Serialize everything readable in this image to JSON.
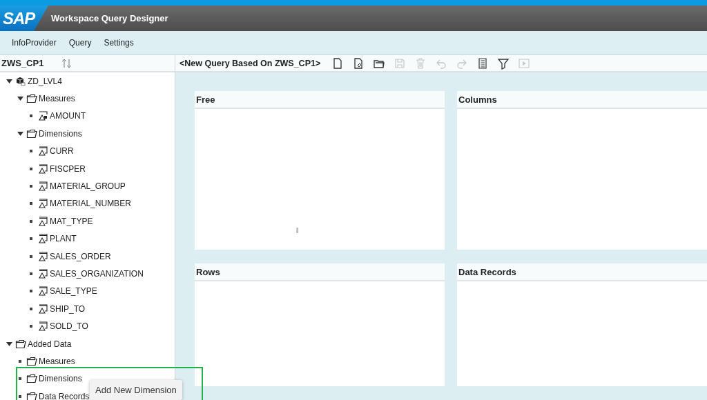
{
  "header": {
    "logo": "SAP",
    "title": "Workspace Query Designer"
  },
  "menu": [
    "InfoProvider",
    "Query",
    "Settings"
  ],
  "provider": {
    "title": "ZWS_CP1"
  },
  "tree": [
    {
      "label": "ZD_LVL4",
      "kind": "cube",
      "expanded": true,
      "children": [
        {
          "label": "Measures",
          "kind": "folder",
          "expanded": true,
          "children": [
            {
              "label": "AMOUNT",
              "kind": "measure"
            }
          ]
        },
        {
          "label": "Dimensions",
          "kind": "folder",
          "expanded": true,
          "children": [
            {
              "label": "CURR",
              "kind": "dimension"
            },
            {
              "label": "FISCPER",
              "kind": "dimension"
            },
            {
              "label": "MATERIAL_GROUP",
              "kind": "dimension"
            },
            {
              "label": "MATERIAL_NUMBER",
              "kind": "dimension"
            },
            {
              "label": "MAT_TYPE",
              "kind": "dimension"
            },
            {
              "label": "PLANT",
              "kind": "dimension"
            },
            {
              "label": "SALES_ORDER",
              "kind": "dimension"
            },
            {
              "label": "SALES_ORGANIZATION",
              "kind": "dimension"
            },
            {
              "label": "SALE_TYPE",
              "kind": "dimension"
            },
            {
              "label": "SHIP_TO",
              "kind": "dimension"
            },
            {
              "label": "SOLD_TO",
              "kind": "dimension"
            }
          ]
        }
      ]
    },
    {
      "label": "Added Data",
      "kind": "folder",
      "expanded": true,
      "children": [
        {
          "label": "Measures",
          "kind": "folder"
        },
        {
          "label": "Dimensions",
          "kind": "folder"
        },
        {
          "label": "Data Records",
          "kind": "folder"
        }
      ]
    }
  ],
  "query": {
    "title": "<New Query Based On ZWS_CP1>"
  },
  "toolbar": [
    {
      "kind": "new",
      "disabled": false
    },
    {
      "kind": "edit",
      "disabled": false
    },
    {
      "kind": "open",
      "disabled": false
    },
    {
      "kind": "save",
      "disabled": true
    },
    {
      "kind": "delete",
      "disabled": true
    },
    {
      "kind": "undo",
      "disabled": true
    },
    {
      "kind": "redo",
      "disabled": true
    },
    {
      "kind": "list",
      "disabled": false
    },
    {
      "kind": "filter",
      "disabled": false
    },
    {
      "kind": "execute",
      "disabled": true
    }
  ],
  "panels": [
    "Free",
    "Columns",
    "Rows",
    "Data Records"
  ],
  "context_menu": {
    "item": "Add New Dimension"
  }
}
